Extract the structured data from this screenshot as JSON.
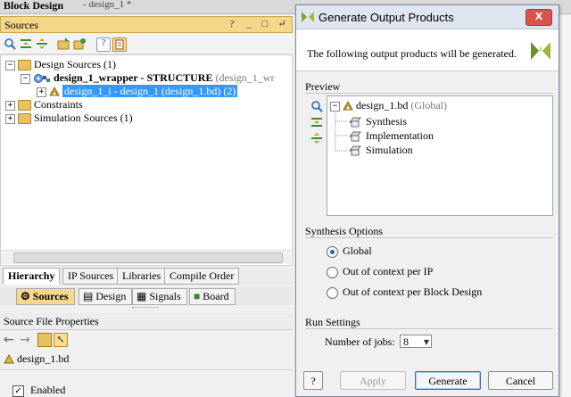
{
  "window": {
    "title": "Block Design",
    "subtitle": "- design_1 *"
  },
  "sources_panel": {
    "title": "Sources",
    "header_buttons": [
      "?",
      "_",
      "□",
      "↵"
    ],
    "toolbar_icons": [
      "search-icon",
      "collapse-all-icon",
      "expand-all-icon",
      "add-sources-icon",
      "add-ip-icon",
      "help-icon",
      "properties-icon"
    ],
    "tree": [
      {
        "label": "Design Sources",
        "count": "(1)",
        "expander": "−"
      },
      {
        "label": "design_1_wrapper - STRUCTURE",
        "extra": "(design_1_wr",
        "expander": "−"
      },
      {
        "label": "design_1_i - design_1 (design_1.bd) (2)",
        "expander": "+",
        "selected": true
      },
      {
        "label": "Constraints",
        "expander": "+"
      },
      {
        "label": "Simulation Sources",
        "count": "(1)",
        "expander": "+"
      }
    ],
    "subtabs": [
      "Hierarchy",
      "IP Sources",
      "Libraries",
      "Compile Order"
    ],
    "main_tabs": [
      "Sources",
      "Design",
      "Signals",
      "Board"
    ]
  },
  "source_file_properties": {
    "title": "Source File Properties",
    "file": "design_1.bd",
    "enabled_label": "Enabled",
    "enabled_checked": "✓"
  },
  "dialog": {
    "title": "Generate Output Products",
    "close_label": "X",
    "message": "The following output products will be generated.",
    "preview_label": "Preview",
    "preview_tree": {
      "root": "design_1.bd",
      "root_note": "(Global)",
      "children": [
        "Synthesis",
        "Implementation",
        "Simulation"
      ]
    },
    "synthesis_options_label": "Synthesis Options",
    "options": [
      {
        "label": "Global",
        "selected": true
      },
      {
        "label": "Out of context per IP",
        "selected": false
      },
      {
        "label": "Out of context per Block Design",
        "selected": false
      }
    ],
    "run_settings_label": "Run Settings",
    "jobs_label": "Number of jobs:",
    "jobs_value": "8",
    "help_label": "?",
    "apply_label": "Apply",
    "generate_label": "Generate",
    "cancel_label": "Cancel"
  },
  "colors": {
    "sources_header": "#f5d78a",
    "selection": "#3399ff",
    "active_tab": "#f7d88f"
  }
}
